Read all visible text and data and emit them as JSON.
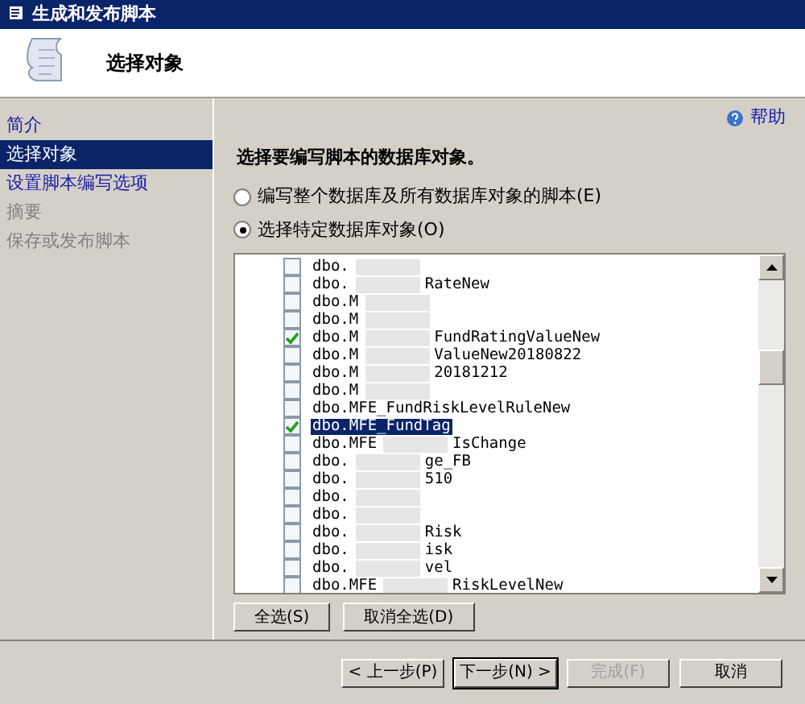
{
  "window": {
    "title": "生成和发布脚本"
  },
  "header": {
    "title": "选择对象"
  },
  "sidebar": {
    "items": [
      {
        "label": "简介",
        "selected": false,
        "disabled": false
      },
      {
        "label": "选择对象",
        "selected": true,
        "disabled": false
      },
      {
        "label": "设置脚本编写选项",
        "selected": false,
        "disabled": false
      },
      {
        "label": "摘要",
        "selected": false,
        "disabled": true
      },
      {
        "label": "保存或发布脚本",
        "selected": false,
        "disabled": true
      }
    ]
  },
  "help": {
    "label": "帮助"
  },
  "heading": "选择要编写脚本的数据库对象。",
  "options": [
    {
      "label": "编写整个数据库及所有数据库对象的脚本(E)",
      "selected": false
    },
    {
      "label": "选择特定数据库对象(O)",
      "selected": true
    }
  ],
  "objects": [
    {
      "prefix": "dbo.",
      "checked": false,
      "selected": false,
      "blurred": true
    },
    {
      "prefix": "dbo.",
      "suffix": "RateNew",
      "checked": false,
      "selected": false,
      "blurred": true
    },
    {
      "prefix": "dbo.M",
      "checked": false,
      "selected": false,
      "blurred": true
    },
    {
      "prefix": "dbo.M",
      "checked": false,
      "selected": false,
      "blurred": true
    },
    {
      "prefix": "dbo.M",
      "suffix": "FundRatingValueNew",
      "checked": true,
      "selected": false,
      "blurred": true
    },
    {
      "prefix": "dbo.M",
      "suffix": "ValueNew20180822",
      "checked": false,
      "selected": false,
      "blurred": true
    },
    {
      "prefix": "dbo.M",
      "suffix": "20181212",
      "checked": false,
      "selected": false,
      "blurred": true
    },
    {
      "prefix": "dbo.M",
      "checked": false,
      "selected": false,
      "blurred": true
    },
    {
      "prefix": "dbo.MFE_FundRiskLevelRuleNew",
      "checked": false,
      "selected": false,
      "blurred": false
    },
    {
      "prefix": "dbo.MFE_FundTag",
      "checked": true,
      "selected": true,
      "blurred": false
    },
    {
      "prefix": "dbo.MFE",
      "suffix": "IsChange",
      "checked": false,
      "selected": false,
      "blurred": true
    },
    {
      "prefix": "dbo.",
      "suffix": "ge_FB",
      "checked": false,
      "selected": false,
      "blurred": true
    },
    {
      "prefix": "dbo.",
      "suffix": "510",
      "checked": false,
      "selected": false,
      "blurred": true
    },
    {
      "prefix": "dbo.",
      "checked": false,
      "selected": false,
      "blurred": true
    },
    {
      "prefix": "dbo.",
      "checked": false,
      "selected": false,
      "blurred": true
    },
    {
      "prefix": "dbo.",
      "suffix": "Risk",
      "checked": false,
      "selected": false,
      "blurred": true
    },
    {
      "prefix": "dbo.",
      "suffix": "isk",
      "checked": false,
      "selected": false,
      "blurred": true
    },
    {
      "prefix": "dbo.",
      "suffix": "vel",
      "checked": false,
      "selected": false,
      "blurred": true
    },
    {
      "prefix": "dbo.MFE",
      "suffix": "RiskLevelNew",
      "checked": false,
      "selected": false,
      "blurred": true
    }
  ],
  "list_buttons": [
    {
      "label": "全选(S)"
    },
    {
      "label": "取消全选(D)"
    }
  ],
  "footer_buttons": [
    {
      "label": "< 上一步(P)",
      "disabled": false,
      "default": false
    },
    {
      "label": "下一步(N) >",
      "disabled": false,
      "default": true
    },
    {
      "label": "完成(F)",
      "disabled": true,
      "default": false
    },
    {
      "label": "取消",
      "disabled": false,
      "default": false
    }
  ]
}
